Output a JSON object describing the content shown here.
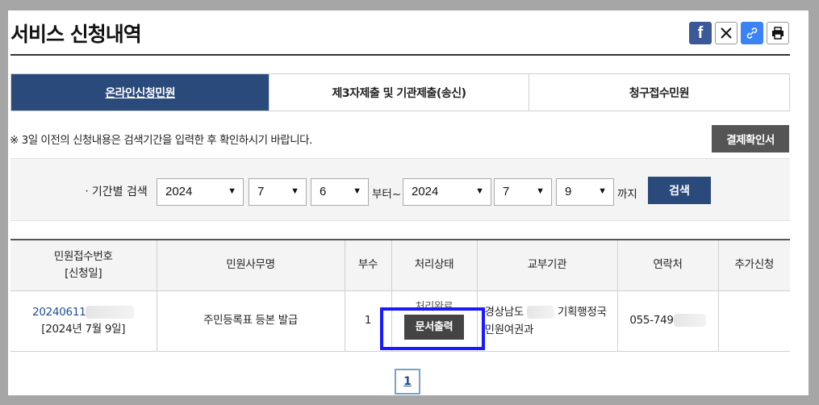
{
  "page": {
    "title": "서비스 신청내역"
  },
  "share": {
    "facebook_icon": "facebook-icon",
    "x_icon": "x-icon",
    "link_icon": "link-icon",
    "print_icon": "print-icon",
    "facebook_glyph": "f"
  },
  "tabs": [
    {
      "label": "온라인신청민원",
      "active": true
    },
    {
      "label": "제3자제출 및 기관제출(송신)",
      "active": false
    },
    {
      "label": "청구접수민원",
      "active": false
    }
  ],
  "notice": "※ 3일 이전의 신청내용은 검색기간을 입력한 후 확인하시기 바랍니다.",
  "receipt_confirm_button": "결제확인서",
  "search": {
    "label": "ㆍ기간별 검색",
    "from_year": "2024",
    "from_month": "7",
    "from_day": "6",
    "from_suffix": "부터~",
    "to_year": "2024",
    "to_month": "7",
    "to_day": "9",
    "to_suffix": "까지",
    "button": "검색"
  },
  "table": {
    "headers": {
      "receipt_no": "민원접수번호",
      "apply_date": "[신청일]",
      "service_name": "민원사무명",
      "copies": "부수",
      "status": "처리상태",
      "issuing_org": "교부기관",
      "contact": "연락처",
      "extra": "추가신청"
    },
    "rows": [
      {
        "receipt_no": "20240611",
        "apply_date": "[2024년 7월 9일]",
        "service_name": "주민등록표 등본 발급",
        "copies": "1",
        "status": "처리완료",
        "print_button": "문서출력",
        "issuing_org_line1a": "경상남도",
        "issuing_org_line1b": "기획행정국",
        "issuing_org_line2": "민원여권과",
        "contact": "055-749"
      }
    ]
  },
  "pagination": {
    "current": "1"
  },
  "colors": {
    "primary": "#294a7a",
    "highlight": "#1a1aff",
    "dark_button": "#555555"
  }
}
